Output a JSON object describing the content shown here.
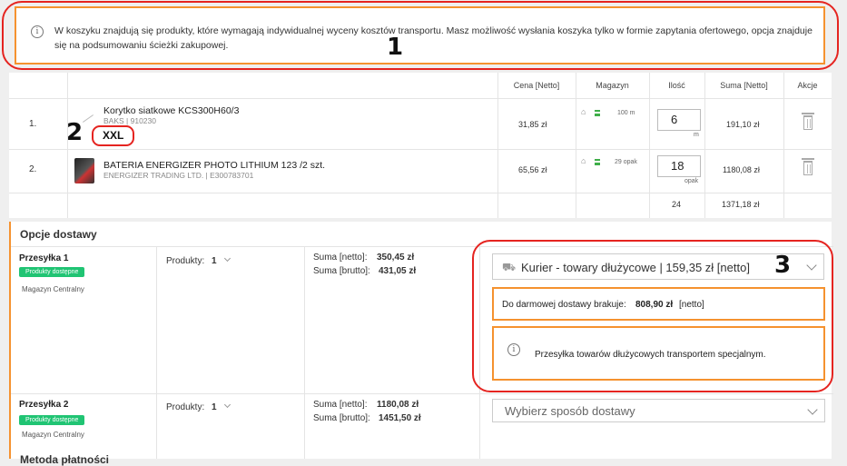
{
  "banner": {
    "text": "W koszyku znajdują się produkty, które wymagają indywidualnej wyceny kosztów transportu. Masz możliwość wysłania koszyka tylko w formie zapytania ofertowego, opcja znajduje się na podsumowaniu ścieżki zakupowej.",
    "icon": "info-icon"
  },
  "annotations": [
    "1",
    "2",
    "3"
  ],
  "cart": {
    "headers": {
      "price": "Cena [Netto]",
      "stock": "Magazyn",
      "qty": "Ilość",
      "sum": "Suma [Netto]",
      "actions": "Akcje"
    },
    "rows": [
      {
        "num": "1.",
        "name": "Korytko siatkowe KCS300H60/3",
        "meta": "BAKS | 910230",
        "tag": "XXL",
        "price": "31,85 zł",
        "stock": "100 m",
        "qty": "6",
        "unit": "m",
        "sum": "191,10 zł"
      },
      {
        "num": "2.",
        "name": "BATERIA ENERGIZER PHOTO LITHIUM 123 /2 szt.",
        "meta": "ENERGIZER TRADING LTD. | E300783701",
        "tag": "",
        "price": "65,56 zł",
        "stock": "29 opak",
        "qty": "18",
        "unit": "opak",
        "sum": "1180,08 zł"
      }
    ],
    "totals": {
      "qty": "24",
      "sum": "1371,18 zł"
    }
  },
  "delivery": {
    "title": "Opcje dostawy",
    "shipments": [
      {
        "title": "Przesyłka 1",
        "badge": "Produkty dostępne",
        "warehouse": "Magazyn Centralny",
        "products_label": "Produkty:",
        "products_count": "1",
        "net_label": "Suma [netto]:",
        "net_value": "350,45 zł",
        "gross_label": "Suma [brutto]:",
        "gross_value": "431,05 zł",
        "method": "Kurier - towary dłużycowe | 159,35 zł [netto]",
        "free_label": "Do darmowej dostawy brakuje:",
        "free_value": "808,90 zł",
        "free_suffix": "[netto]",
        "note": "Przesyłka towarów dłużycowych transportem specjalnym."
      },
      {
        "title": "Przesyłka 2",
        "badge": "Produkty dostępne",
        "warehouse": "Magazyn Centralny",
        "products_label": "Produkty:",
        "products_count": "1",
        "net_label": "Suma [netto]:",
        "net_value": "1180,08 zł",
        "gross_label": "Suma [brutto]:",
        "gross_value": "1451,50 zł",
        "method_placeholder": "Wybierz sposób dostawy"
      }
    ],
    "next_section_title": "Metoda płatności"
  },
  "colors": {
    "accent": "#f5922f",
    "annotation": "#e52420",
    "badge": "#20c473"
  }
}
